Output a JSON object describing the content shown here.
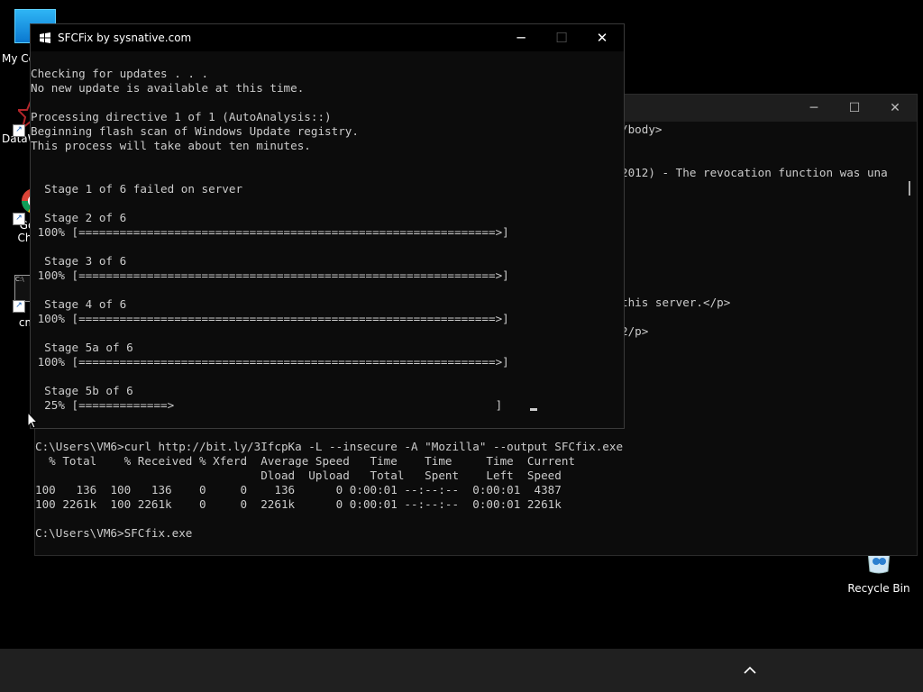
{
  "desktop": {
    "icons": [
      {
        "label": "My Co",
        "icon": "computer-icon"
      },
      {
        "label": "DataW",
        "icon": "datawiper-icon"
      },
      {
        "label": "Go\nChr",
        "icon": "chrome-icon"
      },
      {
        "label": "cm",
        "icon": "cmd-icon"
      }
    ],
    "recycle_bin_label": "Recycle Bin"
  },
  "cmd_window": {
    "background_lines": [
      {
        "text": "/body>"
      },
      {
        "text": ""
      },
      {
        "text": "2012) - The revocation function was una"
      },
      {
        "text": "this server.</p>"
      },
      {
        "text": "2/p>"
      }
    ],
    "lines": [
      "C:\\Users\\VM6>curl http://bit.ly/3IfcpKa -L --insecure -A \"Mozilla\" --output SFCfix.exe",
      "  % Total    % Received % Xferd  Average Speed   Time    Time     Time  Current",
      "                                 Dload  Upload   Total   Spent    Left  Speed",
      "100   136  100   136    0     0    136      0 0:00:01 --:--:--  0:00:01  4387",
      "100 2261k  100 2261k    0     0  2261k      0 0:00:01 --:--:--  0:00:01 2261k",
      "",
      "C:\\Users\\VM6>SFCfix.exe"
    ]
  },
  "sfcfix_window": {
    "title": "SFCFix by sysnative.com",
    "lines": [
      "Checking for updates . . .",
      "No new update is available at this time.",
      "",
      "Processing directive 1 of 1 (AutoAnalysis::)",
      "Beginning flash scan of Windows Update registry.",
      "This process will take about ten minutes.",
      "",
      "",
      "  Stage 1 of 6 failed on server",
      "",
      "  Stage 2 of 6",
      " 100% [=============================================================>]",
      "",
      "  Stage 3 of 6",
      " 100% [=============================================================>]",
      "",
      "  Stage 4 of 6",
      " 100% [=============================================================>]",
      "",
      "  Stage 5a of 6",
      " 100% [=============================================================>]",
      "",
      "  Stage 5b of 6",
      "  25% [=============>                                               ]"
    ]
  },
  "colors": {
    "console_bg": "#0c0c0c",
    "console_text": "#cccccc",
    "taskbar": "#202020"
  }
}
